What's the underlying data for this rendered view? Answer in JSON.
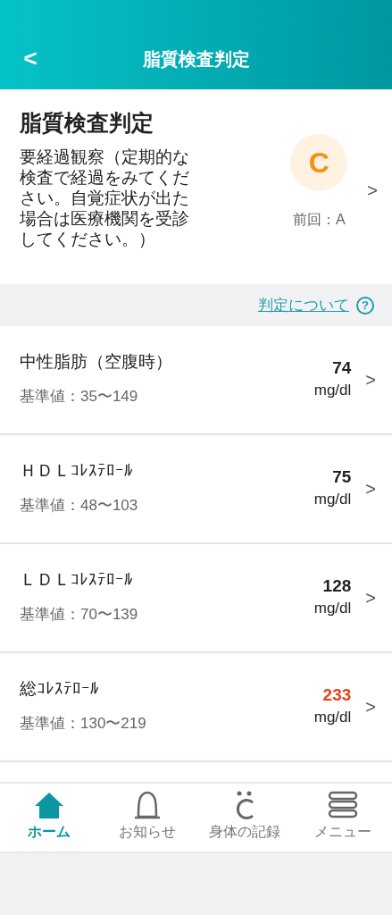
{
  "header": {
    "back": "<",
    "title": "脂質検査判定"
  },
  "summary": {
    "title": "脂質検査判定",
    "description": "要経過観察（定期的な検査で経過をみてください。自覚症状が出た場合は医療機関を受診してください。）",
    "grade": "C",
    "previous": "前回：A",
    "chevron": ">"
  },
  "about_link": {
    "label": "判定について",
    "help": "?"
  },
  "results": [
    {
      "name": "中性脂肪（空腹時）",
      "reference": "基準値：35〜149",
      "value": "74",
      "unit": "mg/dl",
      "out_of_range": false,
      "chevron": ">"
    },
    {
      "name": "ＨＤＬｺﾚｽﾃﾛｰﾙ",
      "reference": "基準値：48〜103",
      "value": "75",
      "unit": "mg/dl",
      "out_of_range": false,
      "chevron": ">"
    },
    {
      "name": "ＬＤＬｺﾚｽﾃﾛｰﾙ",
      "reference": "基準値：70〜139",
      "value": "128",
      "unit": "mg/dl",
      "out_of_range": false,
      "chevron": ">"
    },
    {
      "name": "総ｺﾚｽﾃﾛｰﾙ",
      "reference": "基準値：130〜219",
      "value": "233",
      "unit": "mg/dl",
      "out_of_range": true,
      "chevron": ">"
    }
  ],
  "bottom_nav": [
    {
      "label": "ホーム",
      "kind": "home",
      "selected": true
    },
    {
      "label": "お知らせ",
      "kind": "bell",
      "selected": false
    },
    {
      "label": "身体の記録",
      "kind": "body",
      "selected": false
    },
    {
      "label": "メニュー",
      "kind": "menu",
      "selected": false
    }
  ]
}
